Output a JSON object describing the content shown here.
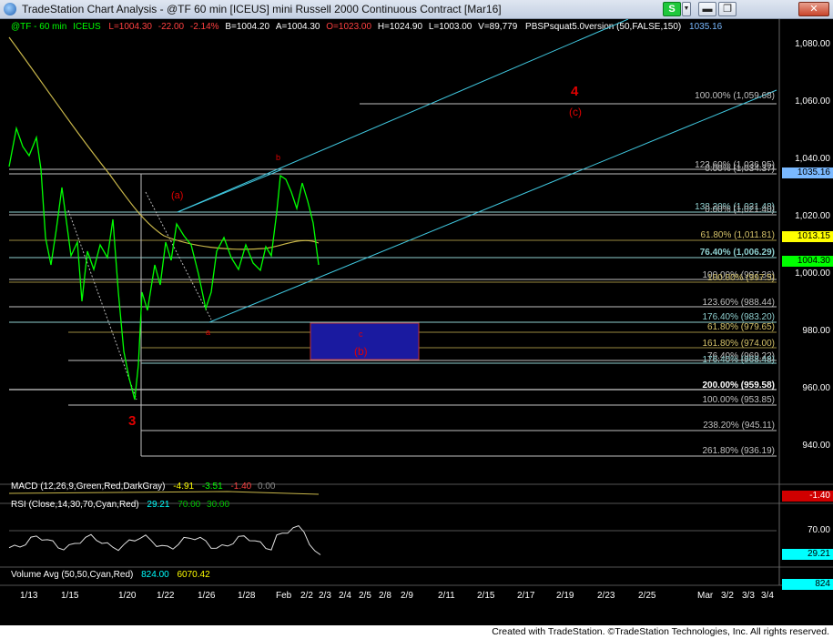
{
  "window": {
    "app_title": "TradeStation Chart Analysis - @TF 60 min [ICEUS] mini Russell 2000 Continuous Contract [Mar16]",
    "strategy_button": "S",
    "dropdown_glyph": "▼",
    "min_glyph": "▬",
    "max_glyph": "❐",
    "close_glyph": "✕"
  },
  "header": {
    "symbol": "@TF - 60 min",
    "exchange": "ICEUS",
    "last": "L=1004.30",
    "change": "-22.00",
    "pct": "-2.14%",
    "bid": "B=1004.20",
    "ask": "A=1004.30",
    "open": "O=1023.00",
    "high": "H=1024.90",
    "low": "L=1003.00",
    "volume": "V=89,779",
    "study": "PBSPsquat5.0version (50,FALSE,150)",
    "study_value": "1035.16"
  },
  "price_axis": {
    "ticks": [
      "1,080.00",
      "1,060.00",
      "1,040.00",
      "1,020.00",
      "1,000.00",
      "980.00",
      "960.00",
      "940.00"
    ],
    "markers": [
      {
        "value": "1035.16",
        "bg": "#7ab9ff",
        "fg": "#000000"
      },
      {
        "value": "1013.15",
        "bg": "#ffff00",
        "fg": "#000000"
      },
      {
        "value": "1004.30",
        "bg": "#00ff00",
        "fg": "#000000"
      }
    ]
  },
  "fib_levels": [
    {
      "text": "100.00% (1,059.68)",
      "color": "#c0c0c0"
    },
    {
      "text": "123.60% (1,036.95)",
      "color": "#c0c0c0"
    },
    {
      "text": "0.00% (1,034.37)",
      "color": "#c0c0c0"
    },
    {
      "text": "138.20% (1,021.48)",
      "color": "#8fd0d0"
    },
    {
      "text": "0.00% (1,021.40)",
      "color": "#c0c0c0"
    },
    {
      "text": "61.80% (1,011.81)",
      "color": "#d7c46a"
    },
    {
      "text": "76.40% (1,006.29)",
      "color": "#8fd0d0"
    },
    {
      "text": "100.00% (997.36)",
      "color": "#c0c0c0"
    },
    {
      "text": "100.00% (997.5)",
      "color": "#d7c46a"
    },
    {
      "text": "123.60% (988.44)",
      "color": "#c0c0c0"
    },
    {
      "text": "176.40% (983.20)",
      "color": "#8fd0d0"
    },
    {
      "text": "61.80% (979.65)",
      "color": "#d7c46a"
    },
    {
      "text": "161.80% (974.00)",
      "color": "#d7c46a"
    },
    {
      "text": "76.40% (969.22)",
      "color": "#c0c0c0"
    },
    {
      "text": "176.40% (968.48)",
      "color": "#8fd0d0"
    },
    {
      "text": "200.00% (959.58)",
      "color": "#ffffff"
    },
    {
      "text": "100.00% (953.85)",
      "color": "#c0c0c0"
    },
    {
      "text": "238.20% (945.11)",
      "color": "#c0c0c0"
    },
    {
      "text": "261.80% (936.19)",
      "color": "#c0c0c0"
    }
  ],
  "wave_labels": [
    {
      "text": "4",
      "color": "#e00000"
    },
    {
      "text": "(c)",
      "color": "#e00000"
    },
    {
      "text": "(a)",
      "color": "#e00000"
    },
    {
      "text": "b",
      "color": "#e00000"
    },
    {
      "text": "a",
      "color": "#e00000"
    },
    {
      "text": "c",
      "color": "#e00000"
    },
    {
      "text": "(b)",
      "color": "#e00000"
    },
    {
      "text": "3",
      "color": "#e00000"
    }
  ],
  "macd": {
    "label": "MACD (12,26,9,Green,Red,DarkGray)",
    "v1": "-4.91",
    "v2": "-3.51",
    "v3": "-1.40",
    "v4": "0.00",
    "axis_value": "-1.40"
  },
  "rsi": {
    "label": "RSI (Close,14,30,70,Cyan,Red)",
    "value": "29.21",
    "ob": "70.00",
    "os": "30.00",
    "axis_ticks": [
      "70.00",
      "30.00"
    ],
    "axis_value": "29.21"
  },
  "volume": {
    "label": "Volume Avg (50,50,Cyan,Red)",
    "v1": "824.00",
    "v2": "6070.42",
    "axis_value": "824"
  },
  "date_axis": [
    "1/13",
    "1/15",
    "1/20",
    "1/22",
    "1/26",
    "1/28",
    "Feb",
    "2/2",
    "2/3",
    "2/4",
    "2/5",
    "2/8",
    "2/9",
    "2/11",
    "2/15",
    "2/17",
    "2/19",
    "2/23",
    "2/25",
    "Mar",
    "3/2",
    "3/3",
    "3/4"
  ],
  "footer": "Created with TradeStation. ©TradeStation Technologies, Inc. All rights reserved.",
  "colors": {
    "price": "#00ff00",
    "ma": "#c8b64a",
    "channel": "#40c8e0",
    "wave": "#e00000",
    "box": "#1a1aa0"
  }
}
